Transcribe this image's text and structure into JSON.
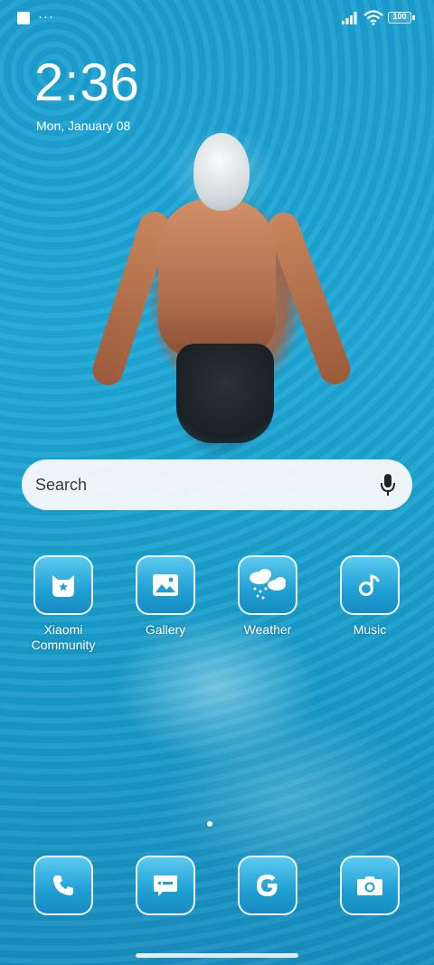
{
  "status_bar": {
    "notification_dots": "···",
    "battery_level": "100"
  },
  "lock": {
    "time": "2:36",
    "date": "Mon, January 08"
  },
  "search": {
    "placeholder": "Search"
  },
  "apps": [
    {
      "label": "Xiaomi Community",
      "icon": "xiaomi-community-icon"
    },
    {
      "label": "Gallery",
      "icon": "gallery-icon"
    },
    {
      "label": "Weather",
      "icon": "weather-icon"
    },
    {
      "label": "Music",
      "icon": "music-icon"
    }
  ],
  "dock": [
    {
      "icon": "phone-icon"
    },
    {
      "icon": "messages-icon"
    },
    {
      "icon": "google-icon"
    },
    {
      "icon": "camera-icon"
    }
  ],
  "colors": {
    "accent": "#1f9fd3",
    "search_bg": "#f5f8f9"
  }
}
